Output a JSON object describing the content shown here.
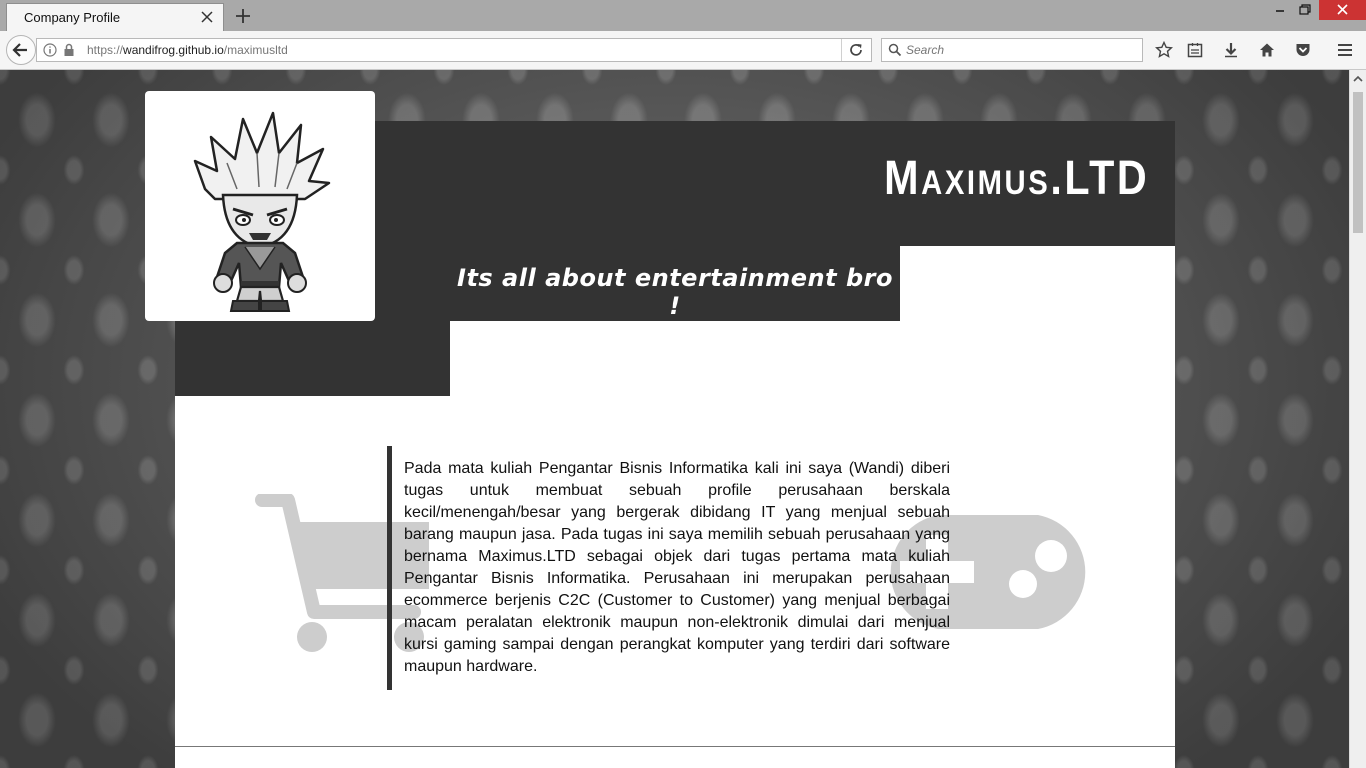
{
  "browser": {
    "tab_title": "Company Profile",
    "url_scheme": "https://",
    "url_host": "wandifrog.github.io",
    "url_path": "/maximusltd",
    "search_placeholder": "Search"
  },
  "page": {
    "brand": "Maximus.LTD",
    "tagline": "Its all about entertainment bro !",
    "description": "Pada mata kuliah Pengantar Bisnis Informatika kali ini saya (Wandi) diberi tugas untuk membuat sebuah profile perusahaan berskala kecil/menengah/besar yang bergerak dibidang IT yang menjual sebuah barang maupun jasa. Pada tugas ini saya memilih sebuah perusahaan yang bernama Maximus.LTD sebagai objek dari tugas pertama mata kuliah Pengantar Bisnis Informatika. Perusahaan ini merupakan perusahaan ecommerce berjenis C2C (Customer to Customer) yang menjual berbagai macam peralatan elektronik maupun non-elektronik dimulai dari menjual kursi gaming sampai dengan perangkat komputer yang terdiri dari software maupun hardware."
  },
  "colors": {
    "header_dark": "#333333",
    "icon_gray": "#cdcdcd",
    "content_bg": "#ffffff"
  },
  "icons": {
    "logo": "anime-character-logo",
    "left_background": "shopping-cart-icon",
    "right_background": "gamepad-icon"
  }
}
